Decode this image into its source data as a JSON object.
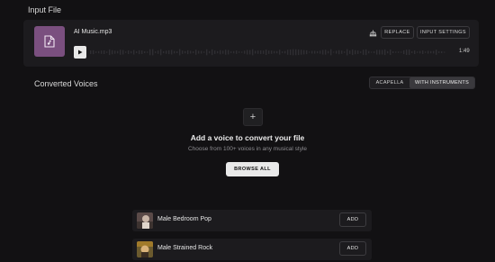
{
  "input_section": {
    "title": "Input File"
  },
  "file": {
    "name": "AI Music.mp3",
    "duration": "1:49",
    "icon": "audio-file-icon"
  },
  "file_actions": {
    "replace": "REPLACE",
    "input_settings": "INPUT SETTINGS"
  },
  "converted": {
    "title": "Converted Voices",
    "toggle": {
      "acapella": "ACAPELLA",
      "with_instruments": "WITH INSTRUMENTS",
      "selected": "WITH INSTRUMENTS"
    }
  },
  "empty_state": {
    "heading": "Add a voice to convert your file",
    "subtext": "Choose from 100+ voices in any musical style",
    "button": "BROWSE ALL"
  },
  "voices": [
    {
      "name": "Male Bedroom Pop",
      "add": "ADD"
    },
    {
      "name": "Male Strained Rock",
      "add": "ADD"
    }
  ],
  "colors": {
    "background": "#121113",
    "card": "#1c1b1e",
    "file_icon": "#7a4f7f",
    "primary_button": "#e9e9e9"
  }
}
